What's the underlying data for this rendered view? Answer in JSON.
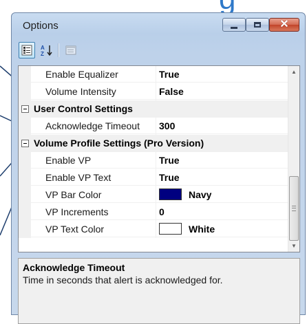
{
  "window": {
    "title": "Options",
    "background_heading_fragment": "g",
    "controls": {
      "minimize_icon": "minimize-icon",
      "maximize_icon": "maximize-icon",
      "close_icon": "close-icon"
    }
  },
  "toolbar": {
    "categorized_icon": "categorized-view-icon",
    "alphabetical_icon": "alphabetical-sort-icon",
    "property_pages_icon": "property-pages-icon"
  },
  "grid": {
    "rows": [
      {
        "type": "property",
        "name": "Enable Equalizer",
        "value": "True"
      },
      {
        "type": "property",
        "name": "Volume Intensity",
        "value": "False"
      },
      {
        "type": "category",
        "label": "User Control Settings",
        "expanded": true
      },
      {
        "type": "property",
        "name": "Acknowledge Timeout",
        "value": "300"
      },
      {
        "type": "category",
        "label": "Volume Profile Settings (Pro Version)",
        "expanded": true
      },
      {
        "type": "property",
        "name": "Enable VP",
        "value": "True"
      },
      {
        "type": "property",
        "name": "Enable VP Text",
        "value": "True"
      },
      {
        "type": "property",
        "name": "VP Bar Color",
        "value": "Navy",
        "swatch": "#000080"
      },
      {
        "type": "property",
        "name": "VP Increments",
        "value": "0"
      },
      {
        "type": "property",
        "name": "VP Text Color",
        "value": "White",
        "swatch": "#ffffff"
      }
    ]
  },
  "description": {
    "title": "Acknowledge Timeout",
    "text": "Time in seconds that alert is acknowledged for."
  },
  "colors": {
    "title_accent": "#2f79c9",
    "callout_line": "#1f3f6e",
    "navy": "#000080",
    "white": "#ffffff"
  }
}
